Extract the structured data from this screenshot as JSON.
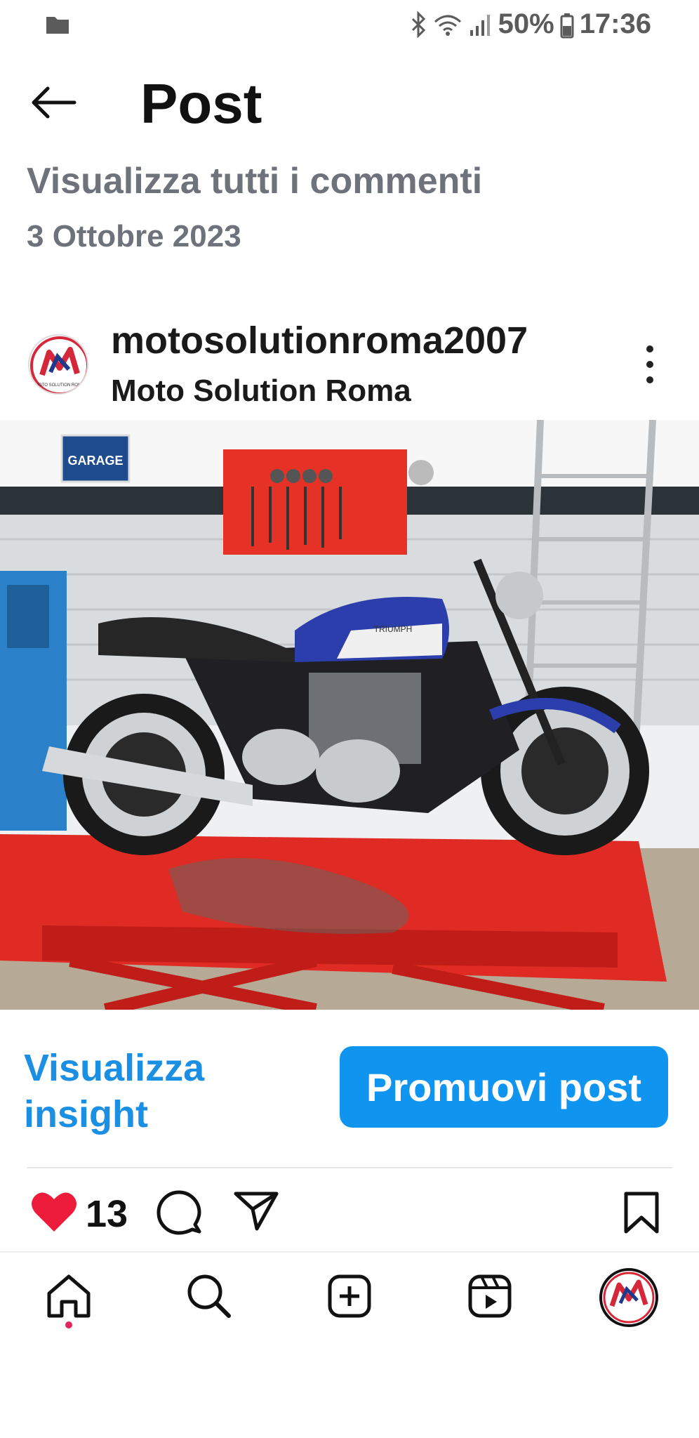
{
  "status_bar": {
    "battery": "50%",
    "time": "17:36",
    "icons": [
      "folder-icon",
      "bluetooth-icon",
      "wifi-icon",
      "signal-icon",
      "battery-icon"
    ]
  },
  "header": {
    "title": "Post"
  },
  "comments": {
    "view_all_label": "Visualizza tutti i commenti",
    "date": "3 Ottobre 2023"
  },
  "post": {
    "username": "motosolutionroma2007",
    "display_name": "Moto Solution Roma",
    "avatar_text": "MOTO SOLUTION ROMA",
    "image_sign": "GARAGE",
    "image_brand": "TRIUMPH"
  },
  "insights": {
    "link_line1": "Visualizza",
    "link_line2": "insight",
    "promote_label": "Promuovi post"
  },
  "actions": {
    "like_count": "13",
    "like_color": "#ed1c3b"
  },
  "bottom_nav": {
    "items": [
      "home-icon",
      "search-icon",
      "create-icon",
      "reels-icon",
      "profile-avatar"
    ]
  },
  "colors": {
    "accent_blue": "#0f95f0",
    "link_blue": "#1a8fe3",
    "muted_text": "#6e737b"
  }
}
